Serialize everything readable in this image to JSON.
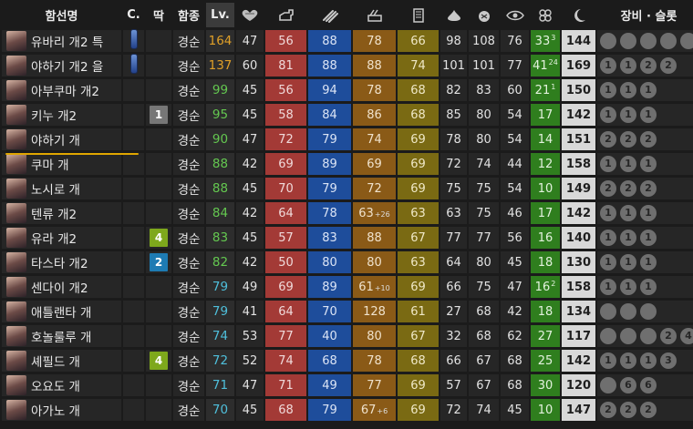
{
  "columns": {
    "name": "함선명",
    "c": "C.",
    "lock": "딱",
    "type": "함종",
    "lv": "Lv.",
    "equipment": "장비 · 슬롯",
    "stat_icons": [
      "heart-durability-icon",
      "firepower-turret-icon",
      "torpedo-icon",
      "anti-air-icon",
      "armor-icon",
      "evasion-icon",
      "anti-sub-icon",
      "line-of-sight-icon",
      "luck-clover-icon",
      "max-hp-moon-icon"
    ]
  },
  "colors": {
    "firepower": "#a33a36",
    "torpedo": "#1e4d9b",
    "anti_air": "#8a5a17",
    "armor": "#7a6a13",
    "luck": "#2f7e1e",
    "max_hp": "#d8d8d8",
    "badge_green": "#7ea81c",
    "badge_gray": "#777777",
    "badge_blue": "#1e7bb3",
    "lv_cyan": "#4fbfdb",
    "lv_green": "#64c850",
    "lv_orange": "#e0a028",
    "highlight_underline": "#e0a600"
  },
  "rows": [
    {
      "name": "유바리 개2 특",
      "equip_icon": "blue-equip-icon",
      "badge": "",
      "badge_color": "",
      "type": "경순",
      "lv": "164",
      "lv_color": "#e0a028",
      "hp": "47",
      "fp": "56",
      "tp": "88",
      "aa": "78",
      "ar": "66",
      "ev": "98",
      "asw": "108",
      "los": "76",
      "luck": "33",
      "luck_sup": "3",
      "luck_plus": "",
      "maxhp": "144",
      "slots": [
        "",
        "",
        "",
        "",
        ""
      ]
    },
    {
      "name": "야하기 개2 을",
      "equip_icon": "blue-equip-icon",
      "badge": "",
      "badge_color": "",
      "type": "경순",
      "lv": "137",
      "lv_color": "#e0a028",
      "hp": "60",
      "fp": "81",
      "tp": "88",
      "aa": "88",
      "ar": "74",
      "ev": "101",
      "asw": "101",
      "los": "77",
      "luck": "41",
      "luck_sup": "24",
      "luck_plus": "",
      "maxhp": "169",
      "slots": [
        "1",
        "1",
        "2",
        "2"
      ]
    },
    {
      "name": "아부쿠마 개2",
      "equip_icon": "",
      "badge": "",
      "badge_color": "",
      "type": "경순",
      "lv": "99",
      "lv_color": "#64c850",
      "hp": "45",
      "fp": "56",
      "tp": "94",
      "aa": "78",
      "ar": "68",
      "ev": "82",
      "asw": "83",
      "los": "60",
      "luck": "21",
      "luck_sup": "1",
      "luck_plus": "",
      "maxhp": "150",
      "slots": [
        "1",
        "1",
        "1"
      ]
    },
    {
      "name": "키누 개2",
      "equip_icon": "",
      "badge": "1",
      "badge_color": "#777777",
      "type": "경순",
      "lv": "95",
      "lv_color": "#64c850",
      "hp": "45",
      "fp": "58",
      "tp": "84",
      "aa": "86",
      "ar": "68",
      "ev": "85",
      "asw": "80",
      "los": "54",
      "luck": "17",
      "luck_sup": "",
      "luck_plus": "",
      "maxhp": "142",
      "slots": [
        "1",
        "1",
        "1"
      ]
    },
    {
      "name": "야하기 개",
      "equip_icon": "",
      "badge": "",
      "badge_color": "",
      "type": "경순",
      "lv": "90",
      "lv_color": "#64c850",
      "hp": "47",
      "fp": "72",
      "tp": "79",
      "aa": "74",
      "ar": "69",
      "ev": "78",
      "asw": "80",
      "los": "54",
      "luck": "14",
      "luck_sup": "",
      "luck_plus": "",
      "maxhp": "151",
      "slots": [
        "2",
        "2",
        "2"
      ]
    },
    {
      "name": "쿠마 개",
      "equip_icon": "",
      "badge": "",
      "badge_color": "",
      "type": "경순",
      "lv": "88",
      "lv_color": "#64c850",
      "hp": "42",
      "fp": "69",
      "tp": "89",
      "aa": "69",
      "ar": "69",
      "ev": "72",
      "asw": "74",
      "los": "44",
      "luck": "12",
      "luck_sup": "",
      "luck_plus": "",
      "maxhp": "158",
      "slots": [
        "1",
        "1",
        "1"
      ]
    },
    {
      "name": "노시로 개",
      "equip_icon": "",
      "badge": "",
      "badge_color": "",
      "type": "경순",
      "lv": "88",
      "lv_color": "#64c850",
      "hp": "45",
      "fp": "70",
      "tp": "79",
      "aa": "72",
      "ar": "69",
      "ev": "75",
      "asw": "75",
      "los": "54",
      "luck": "10",
      "luck_sup": "",
      "luck_plus": "",
      "maxhp": "149",
      "slots": [
        "2",
        "2",
        "2"
      ]
    },
    {
      "name": "텐류 개2",
      "equip_icon": "",
      "badge": "",
      "badge_color": "",
      "type": "경순",
      "lv": "84",
      "lv_color": "#64c850",
      "hp": "42",
      "fp": "64",
      "tp": "78",
      "aa": "63",
      "aa_plus": "+26",
      "ar": "63",
      "ev": "63",
      "asw": "75",
      "los": "46",
      "luck": "17",
      "luck_sup": "",
      "luck_plus": "",
      "maxhp": "142",
      "slots": [
        "1",
        "1",
        "1"
      ]
    },
    {
      "name": "유라 개2",
      "equip_icon": "",
      "badge": "4",
      "badge_color": "#7ea81c",
      "type": "경순",
      "lv": "83",
      "lv_color": "#64c850",
      "hp": "45",
      "fp": "57",
      "tp": "83",
      "aa": "88",
      "ar": "67",
      "ev": "77",
      "asw": "77",
      "los": "56",
      "luck": "16",
      "luck_sup": "",
      "luck_plus": "",
      "maxhp": "140",
      "slots": [
        "1",
        "1",
        "1"
      ]
    },
    {
      "name": "타스타 개2",
      "equip_icon": "",
      "badge": "2",
      "badge_color": "#1e7bb3",
      "type": "경순",
      "lv": "82",
      "lv_color": "#64c850",
      "hp": "42",
      "fp": "50",
      "tp": "80",
      "aa": "80",
      "ar": "63",
      "ev": "64",
      "asw": "80",
      "los": "45",
      "luck": "18",
      "luck_sup": "",
      "luck_plus": "",
      "maxhp": "130",
      "slots": [
        "1",
        "1",
        "1"
      ]
    },
    {
      "name": "센다이 개2",
      "equip_icon": "",
      "badge": "",
      "badge_color": "",
      "type": "경순",
      "lv": "79",
      "lv_color": "#4fbfdb",
      "hp": "49",
      "fp": "69",
      "tp": "89",
      "aa": "61",
      "aa_plus": "+10",
      "ar": "69",
      "ev": "66",
      "asw": "75",
      "los": "47",
      "luck": "16",
      "luck_sup": "2",
      "luck_plus": "",
      "maxhp": "158",
      "slots": [
        "1",
        "1",
        "1"
      ]
    },
    {
      "name": "애틀랜타 개",
      "equip_icon": "",
      "badge": "",
      "badge_color": "",
      "type": "경순",
      "lv": "79",
      "lv_color": "#4fbfdb",
      "hp": "41",
      "fp": "64",
      "tp": "70",
      "aa": "128",
      "ar": "61",
      "ev": "27",
      "asw": "68",
      "los": "42",
      "luck": "18",
      "luck_sup": "",
      "luck_plus": "",
      "maxhp": "134",
      "slots": [
        "",
        "",
        ""
      ]
    },
    {
      "name": "호놀룰루 개",
      "equip_icon": "",
      "badge": "",
      "badge_color": "",
      "type": "경순",
      "lv": "74",
      "lv_color": "#4fbfdb",
      "hp": "53",
      "fp": "77",
      "tp": "40",
      "aa": "80",
      "ar": "67",
      "ev": "32",
      "asw": "68",
      "los": "62",
      "luck": "27",
      "luck_sup": "",
      "luck_plus": "",
      "maxhp": "117",
      "slots": [
        "",
        "",
        "",
        "2",
        "4"
      ]
    },
    {
      "name": "셰필드 개",
      "equip_icon": "",
      "badge": "4",
      "badge_color": "#7ea81c",
      "type": "경순",
      "lv": "72",
      "lv_color": "#4fbfdb",
      "hp": "52",
      "fp": "74",
      "tp": "68",
      "aa": "78",
      "ar": "68",
      "ev": "66",
      "asw": "67",
      "los": "68",
      "luck": "25",
      "luck_sup": "",
      "luck_plus": "",
      "maxhp": "142",
      "slots": [
        "1",
        "1",
        "1",
        "3"
      ]
    },
    {
      "name": "오요도 개",
      "equip_icon": "",
      "badge": "",
      "badge_color": "",
      "type": "경순",
      "lv": "71",
      "lv_color": "#4fbfdb",
      "hp": "47",
      "fp": "71",
      "tp": "49",
      "aa": "77",
      "ar": "69",
      "ev": "57",
      "asw": "67",
      "los": "68",
      "luck": "30",
      "luck_sup": "",
      "luck_plus": "",
      "maxhp": "120",
      "slots": [
        "",
        "6",
        "6"
      ]
    },
    {
      "name": "아가노 개",
      "equip_icon": "",
      "badge": "",
      "badge_color": "",
      "type": "경순",
      "lv": "70",
      "lv_color": "#4fbfdb",
      "hp": "45",
      "fp": "68",
      "tp": "79",
      "aa": "67",
      "aa_plus": "+6",
      "ar": "69",
      "ev": "72",
      "asw": "74",
      "los": "45",
      "luck": "10",
      "luck_sup": "",
      "luck_plus": "",
      "maxhp": "147",
      "slots": [
        "2",
        "2",
        "2"
      ]
    }
  ]
}
